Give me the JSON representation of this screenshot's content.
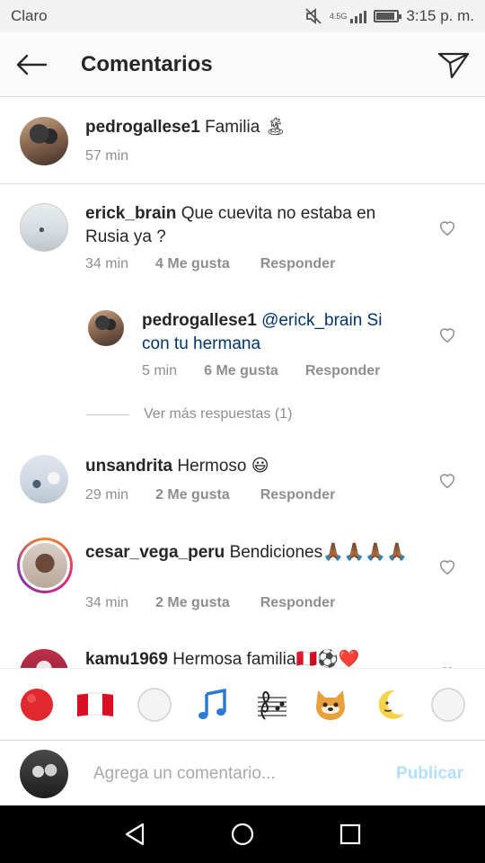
{
  "status_bar": {
    "carrier": "Claro",
    "network": "4.5G",
    "time": "3:15 p. m."
  },
  "header": {
    "title": "Comentarios",
    "back_icon": "arrow-left-icon",
    "send_icon": "paper-plane-icon"
  },
  "caption": {
    "username": "pedrogallese1",
    "text": "Familia 🏝",
    "time": "57 min"
  },
  "comments": [
    {
      "username": "erick_brain",
      "text": "Que cuevita no estaba en Rusia ya ?",
      "time": "34 min",
      "likes": "4 Me gusta",
      "reply": "Responder"
    },
    {
      "username": "pedrogallese1",
      "text": "@erick_brain Si con tu hermana",
      "time": "5 min",
      "likes": "6 Me gusta",
      "reply": "Responder"
    },
    {
      "username": "unsandrita",
      "text": "Hermoso 😃",
      "time": "29 min",
      "likes": "2 Me gusta",
      "reply": "Responder"
    },
    {
      "username": "cesar_vega_peru",
      "text": "Bendiciones🙏🏾🙏🏾🙏🏾🙏🏾",
      "time": "34 min",
      "likes": "2 Me gusta",
      "reply": "Responder"
    },
    {
      "username": "kamu1969",
      "text": "Hermosa familia🇵🇪⚽❤️"
    }
  ],
  "more_replies": "Ver más respuestas (1)",
  "emoji_bar": [
    "🔴",
    "🇵🇪",
    "⚪",
    "🎵",
    "🎼",
    "🐶",
    "🌜",
    "⚪"
  ],
  "input": {
    "placeholder": "Agrega un comentario...",
    "publish": "Publicar"
  },
  "colors": {
    "accent_disabled": "#b2dffc",
    "text_primary": "#262626",
    "text_secondary": "#8e8e8e",
    "divider": "#dbdbdb"
  }
}
